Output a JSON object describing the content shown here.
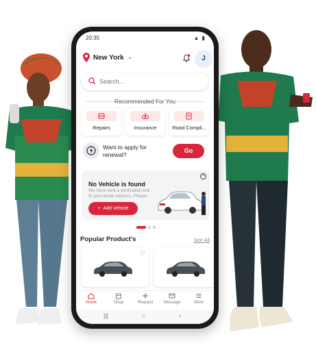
{
  "status_bar": {
    "time": "20:35",
    "icons": "▲ ▮"
  },
  "header": {
    "location": "New York",
    "avatar_initial": "J"
  },
  "search": {
    "placeholder": "Search..."
  },
  "recommended": {
    "title": "Recommended For You",
    "items": [
      {
        "label": "Repairs",
        "icon": "wrench-icon"
      },
      {
        "label": "Insurance",
        "icon": "insurance-icon"
      },
      {
        "label": "Road Compli...",
        "icon": "document-icon"
      }
    ]
  },
  "renewal": {
    "text": "Want to apply for renewal?",
    "button": "Go"
  },
  "banner": {
    "title": "No Vehicle is found",
    "subtitle": "We have sent a verification link to your email address. Please",
    "button": "Add Vehicle",
    "close": "×"
  },
  "popular": {
    "title": "Popular Product's",
    "see_all": "See All"
  },
  "tabbar": {
    "items": [
      {
        "label": "Home",
        "icon": "home-icon"
      },
      {
        "label": "Shop",
        "icon": "shop-icon"
      },
      {
        "label": "Request",
        "icon": "plus-icon"
      },
      {
        "label": "Message",
        "icon": "message-icon"
      },
      {
        "label": "More",
        "icon": "menu-icon"
      }
    ]
  },
  "colors": {
    "accent": "#d9263d",
    "light_accent": "#fde8e8",
    "banner_bg": "#f3f4f6"
  }
}
